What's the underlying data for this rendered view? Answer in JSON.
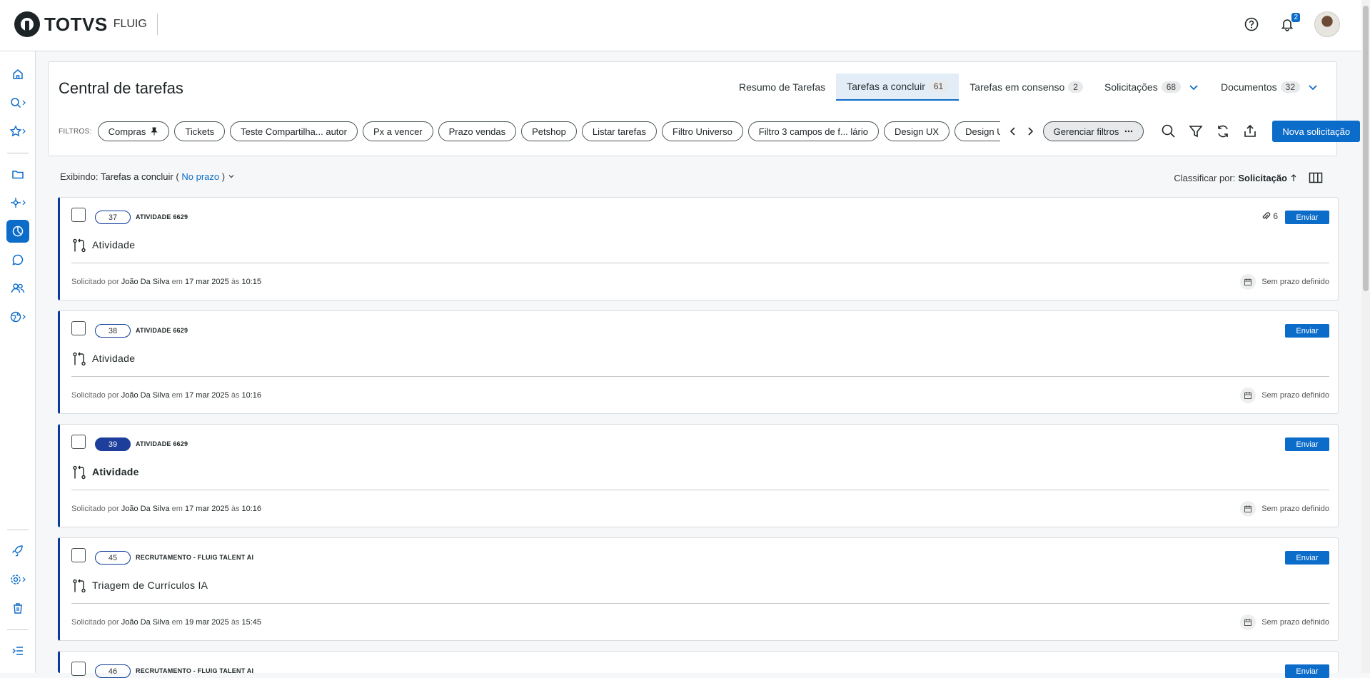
{
  "brand": {
    "name": "TOTVS",
    "product": "FLUIG"
  },
  "header": {
    "notification_count": "2"
  },
  "page": {
    "title": "Central de tarefas"
  },
  "tabs": [
    {
      "label": "Resumo de Tarefas",
      "count": ""
    },
    {
      "label": "Tarefas a concluir",
      "count": "61"
    },
    {
      "label": "Tarefas em consenso",
      "count": "2"
    },
    {
      "label": "Solicitações",
      "count": "68"
    },
    {
      "label": "Documentos",
      "count": "32"
    }
  ],
  "filters": {
    "label": "FILTROS:",
    "chips": [
      "Compras",
      "Tickets",
      "Teste Compartilha... autor",
      "Px a vencer",
      "Prazo vendas",
      "Petshop",
      "Listar tarefas",
      "Filtro Universo",
      "Filtro 3 campos de f... lário",
      "Design UX",
      "Design UI"
    ],
    "manage_label": "Gerenciar filtros",
    "new_request_label": "Nova solicitação"
  },
  "view": {
    "showing_label": "Exibindo:",
    "showing_value": "Tarefas a concluir",
    "showing_open": "(",
    "showing_filter": "No prazo",
    "showing_close": ")",
    "sort_label": "Classificar por:",
    "sort_value": "Solicitação"
  },
  "cards": [
    {
      "number": "37",
      "process": "ATIVIDADE 6629",
      "activity": "Atividade",
      "requested_by_label": "Solicitado por",
      "requester": "João Da Silva",
      "on_label": "em",
      "date": "17 mar 2025",
      "at_label": "às",
      "time": "10:15",
      "deadline": "Sem prazo definido",
      "send_label": "Enviar",
      "attachments": "6"
    },
    {
      "number": "38",
      "process": "ATIVIDADE 6629",
      "activity": "Atividade",
      "requested_by_label": "Solicitado por",
      "requester": "João Da Silva",
      "on_label": "em",
      "date": "17 mar 2025",
      "at_label": "às",
      "time": "10:16",
      "deadline": "Sem prazo definido",
      "send_label": "Enviar"
    },
    {
      "number": "39",
      "process": "ATIVIDADE 6629",
      "activity": "Atividade",
      "requested_by_label": "Solicitado por",
      "requester": "João Da Silva",
      "on_label": "em",
      "date": "17 mar 2025",
      "at_label": "às",
      "time": "10:16",
      "deadline": "Sem prazo definido",
      "send_label": "Enviar"
    },
    {
      "number": "45",
      "process": "RECRUTAMENTO - FLUIG TALENT AI",
      "activity": "Triagem de Currículos IA",
      "requested_by_label": "Solicitado por",
      "requester": "João Da Silva",
      "on_label": "em",
      "date": "19 mar 2025",
      "at_label": "às",
      "time": "15:45",
      "deadline": "Sem prazo definido",
      "send_label": "Enviar"
    },
    {
      "number": "46",
      "process": "RECRUTAMENTO - FLUIG TALENT AI",
      "activity": "",
      "send_label": "Enviar"
    }
  ],
  "colors": {
    "primary": "#0c6cc9",
    "card_accent": "#0c3a9c",
    "selected_badge": "#1d3f9b"
  }
}
